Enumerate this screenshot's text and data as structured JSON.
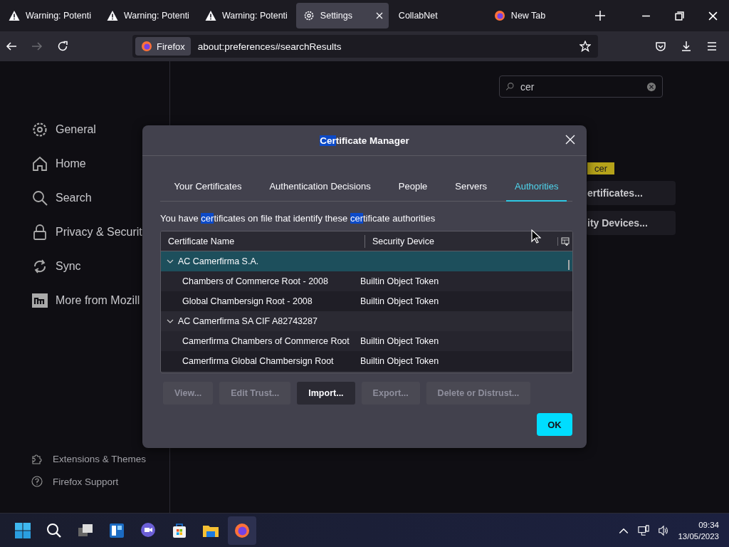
{
  "browser": {
    "tabs": [
      {
        "label": "Warning: Potenti",
        "kind": "warning",
        "selected": false,
        "closable": false
      },
      {
        "label": "Warning: Potenti",
        "kind": "warning",
        "selected": false,
        "closable": false
      },
      {
        "label": "Warning: Potenti",
        "kind": "warning",
        "selected": false,
        "closable": false
      },
      {
        "label": "Settings",
        "kind": "settings",
        "selected": true,
        "closable": true
      },
      {
        "label": "CollabNet",
        "kind": "plain",
        "selected": false,
        "closable": false
      },
      {
        "label": "New Tab",
        "kind": "newtab",
        "selected": false,
        "closable": false
      }
    ],
    "identity": "Firefox",
    "url": "about:preferences#searchResults"
  },
  "settings": {
    "search": {
      "value": "cer"
    },
    "sidebar": [
      "General",
      "Home",
      "Search",
      "Privacy & Securit",
      "Sync",
      "More from Mozill"
    ],
    "footer": [
      "Extensions & Themes",
      "Firefox Support"
    ],
    "tooltip": "cer",
    "buttons": [
      "ertificates...",
      "ity Devices..."
    ]
  },
  "dialog": {
    "title": [
      {
        "text": "Cer",
        "highlighted": true
      },
      {
        "text": "tificate Manager",
        "highlighted": false
      }
    ],
    "tabs": [
      {
        "label": "Your Certificates",
        "selected": false
      },
      {
        "label": "Authentication Decisions",
        "selected": false
      },
      {
        "label": "People",
        "selected": false
      },
      {
        "label": "Servers",
        "selected": false
      },
      {
        "label": "Authorities",
        "selected": true
      }
    ],
    "intro": [
      {
        "text": "You have ",
        "highlighted": false
      },
      {
        "text": "cer",
        "highlighted": true
      },
      {
        "text": "tificates on file that identify these ",
        "highlighted": false
      },
      {
        "text": "cer",
        "highlighted": true
      },
      {
        "text": "tificate authorities",
        "highlighted": false
      }
    ],
    "columns": [
      "Certificate Name",
      "Security Device"
    ],
    "rows": [
      {
        "name": "AC Camerfirma S.A.",
        "expanded": true,
        "selected": true,
        "children": [
          {
            "name": "Chambers of Commerce Root - 2008",
            "device": "Builtin Object Token",
            "selected": false
          },
          {
            "name": "Global Chambersign Root - 2008",
            "device": "Builtin Object Token",
            "selected": false
          }
        ]
      },
      {
        "name": "AC Camerfirma SA CIF A82743287",
        "expanded": true,
        "selected": false,
        "children": [
          {
            "name": "Camerfirma Chambers of Commerce Root",
            "device": "Builtin Object Token",
            "selected": false
          },
          {
            "name": "Camerfirma Global Chambersign Root",
            "device": "Builtin Object Token",
            "selected": false
          }
        ]
      }
    ],
    "buttons": [
      {
        "label": "View...",
        "disabled": true
      },
      {
        "label": "Edit Trust...",
        "disabled": true
      },
      {
        "label": "Import...",
        "disabled": false
      },
      {
        "label": "Export...",
        "disabled": true
      },
      {
        "label": "Delete or Distrust...",
        "disabled": true
      }
    ],
    "ok": "OK"
  },
  "taskbar": {
    "apps": [
      {
        "active": false
      },
      {
        "active": false
      },
      {
        "active": false
      },
      {
        "active": false
      },
      {
        "active": false
      },
      {
        "active": false
      },
      {
        "active": false
      },
      {
        "active": true
      }
    ],
    "time": "09:34",
    "date": "13/05/2023"
  }
}
